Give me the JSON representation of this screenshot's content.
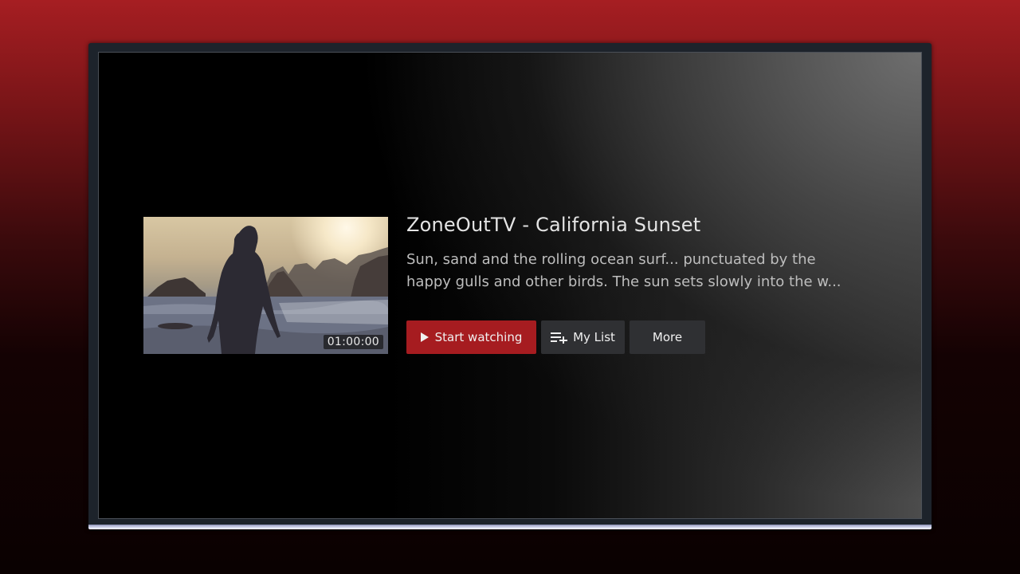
{
  "details": {
    "title": "ZoneOutTV - California Sunset",
    "description_line1": "Sun, sand and the rolling ocean surf... punctuated by the",
    "description_line2": "happy gulls and other birds. The sun sets slowly into the w...",
    "duration": "01:00:00"
  },
  "actions": {
    "start_label": "Start watching",
    "start_icon": "play-icon",
    "mylist_label": "My List",
    "mylist_icon": "playlist-add-icon",
    "more_label": "More"
  },
  "colors": {
    "accent": "#a61c20",
    "button_secondary": "#2f3033",
    "text_primary": "#e4e4e4",
    "text_secondary": "#bdbdbd"
  }
}
